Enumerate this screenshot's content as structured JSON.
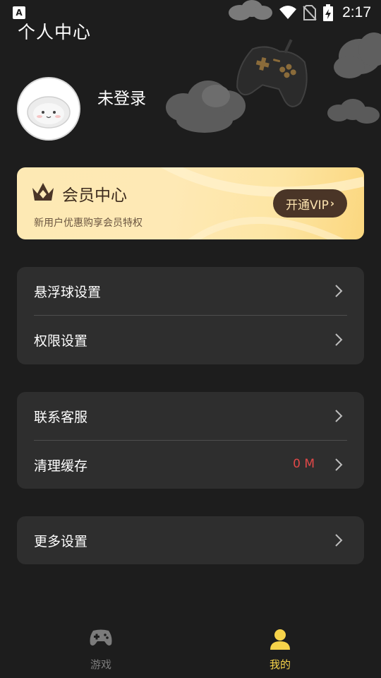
{
  "status_bar": {
    "app_icon": "A",
    "time": "2:17",
    "icons": [
      "wifi-icon",
      "no-sim-icon",
      "battery-charging-icon"
    ]
  },
  "header": {
    "title": "个人中心"
  },
  "profile": {
    "username": "未登录"
  },
  "vip": {
    "title": "会员中心",
    "subtitle": "新用户优惠购享会员特权",
    "button_label": "开通VIP",
    "colors": {
      "card": "#fee9b5",
      "button": "#4a3527",
      "button_text": "#fbe2ae"
    }
  },
  "menu_groups": [
    [
      {
        "label": "悬浮球设置"
      },
      {
        "label": "权限设置"
      }
    ],
    [
      {
        "label": "联系客服"
      },
      {
        "label": "清理缓存",
        "value": "0 M"
      }
    ],
    [
      {
        "label": "更多设置"
      }
    ]
  ],
  "tabs": [
    {
      "label": "游戏",
      "icon": "gamepad-icon",
      "active": false
    },
    {
      "label": "我的",
      "icon": "person-icon",
      "active": true
    }
  ],
  "colors": {
    "background": "#1d1d1d",
    "card": "#2e2e2e",
    "accent": "#f6d34a",
    "danger": "#e04848"
  }
}
